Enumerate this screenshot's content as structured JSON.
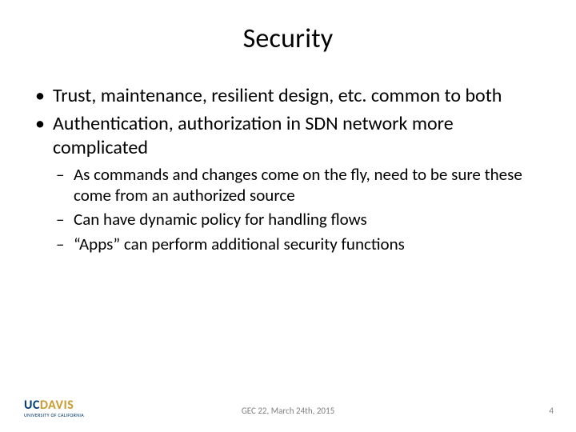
{
  "title": "Security",
  "bullets": {
    "b0": "Trust, maintenance, resilient design, etc. common to both",
    "b1": "Authentication, authorization in SDN network more complicated",
    "b1_sub": {
      "s0": "As commands and changes come on the fly, need to be sure these come from an authorized source",
      "s1": "Can have dynamic policy for handling flows",
      "s2": "“Apps” can perform additional security functions"
    }
  },
  "footer": {
    "logo_uc": "UC",
    "logo_davis": "DAVIS",
    "logo_sub": "UNIVERSITY OF CALIFORNIA",
    "center": "GEC 22, March 24th, 2015",
    "page": "4"
  }
}
